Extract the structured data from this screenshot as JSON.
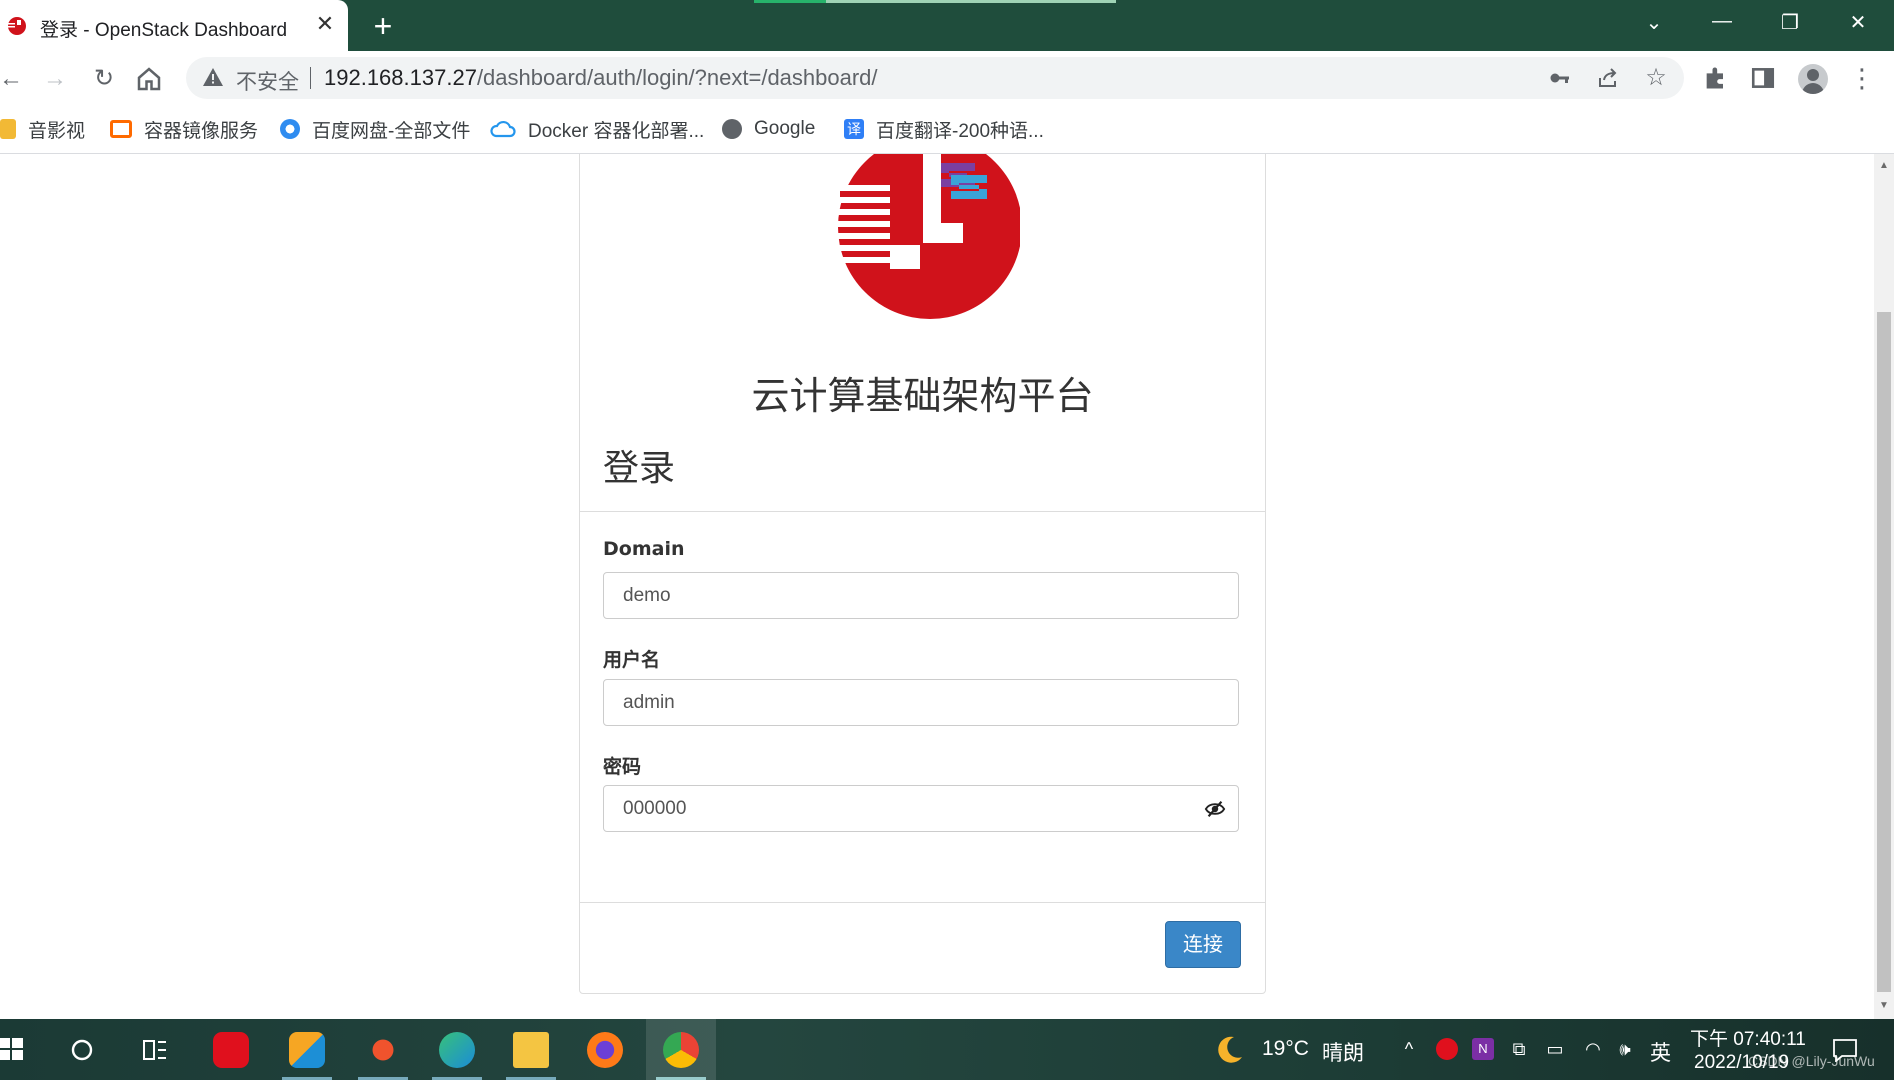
{
  "browser": {
    "tab_title": "登录 - OpenStack Dashboard",
    "tab_close": "✕",
    "new_tab": "+",
    "window_controls": [
      "⌄",
      "—",
      "❐",
      "✕"
    ],
    "insecure_label": "不安全",
    "url_host": "192.168.137.27",
    "url_path": "/dashboard/auth/login/?next=/dashboard/",
    "icons": [
      "back-icon",
      "forward-icon",
      "reload-icon",
      "home-icon",
      "key-icon",
      "share-icon",
      "star-icon",
      "extensions-icon",
      "sidepanel-icon",
      "profile-icon",
      "menu-icon"
    ]
  },
  "bookmarks": [
    {
      "label": "音影视",
      "color": "#f2b935"
    },
    {
      "label": "容器镜像服务",
      "color": "#ff6a00"
    },
    {
      "label": "百度网盘-全部文件",
      "color": "#2f8cf0"
    },
    {
      "label": "Docker 容器化部署...",
      "color": "#2496ed"
    },
    {
      "label": "Google",
      "color": "#5f6368"
    },
    {
      "label": "百度翻译-200种语...",
      "color": "#2f7ff6"
    }
  ],
  "login": {
    "platform_title": "云计算基础架构平台",
    "heading": "登录",
    "domain_label": "Domain",
    "domain_value": "demo",
    "username_label": "用户名",
    "username_value": "admin",
    "password_label": "密码",
    "password_value": "000000",
    "submit_label": "连接",
    "brand_red": "#d0121b",
    "brand_blue": "#3a87c8"
  },
  "taskbar": {
    "weather_temp": "19°C",
    "weather_desc": "晴朗",
    "ime": "英",
    "time": "下午 07:40:11",
    "date": "2022/10/19",
    "watermark": "CSDN @Lily-JunWu"
  }
}
